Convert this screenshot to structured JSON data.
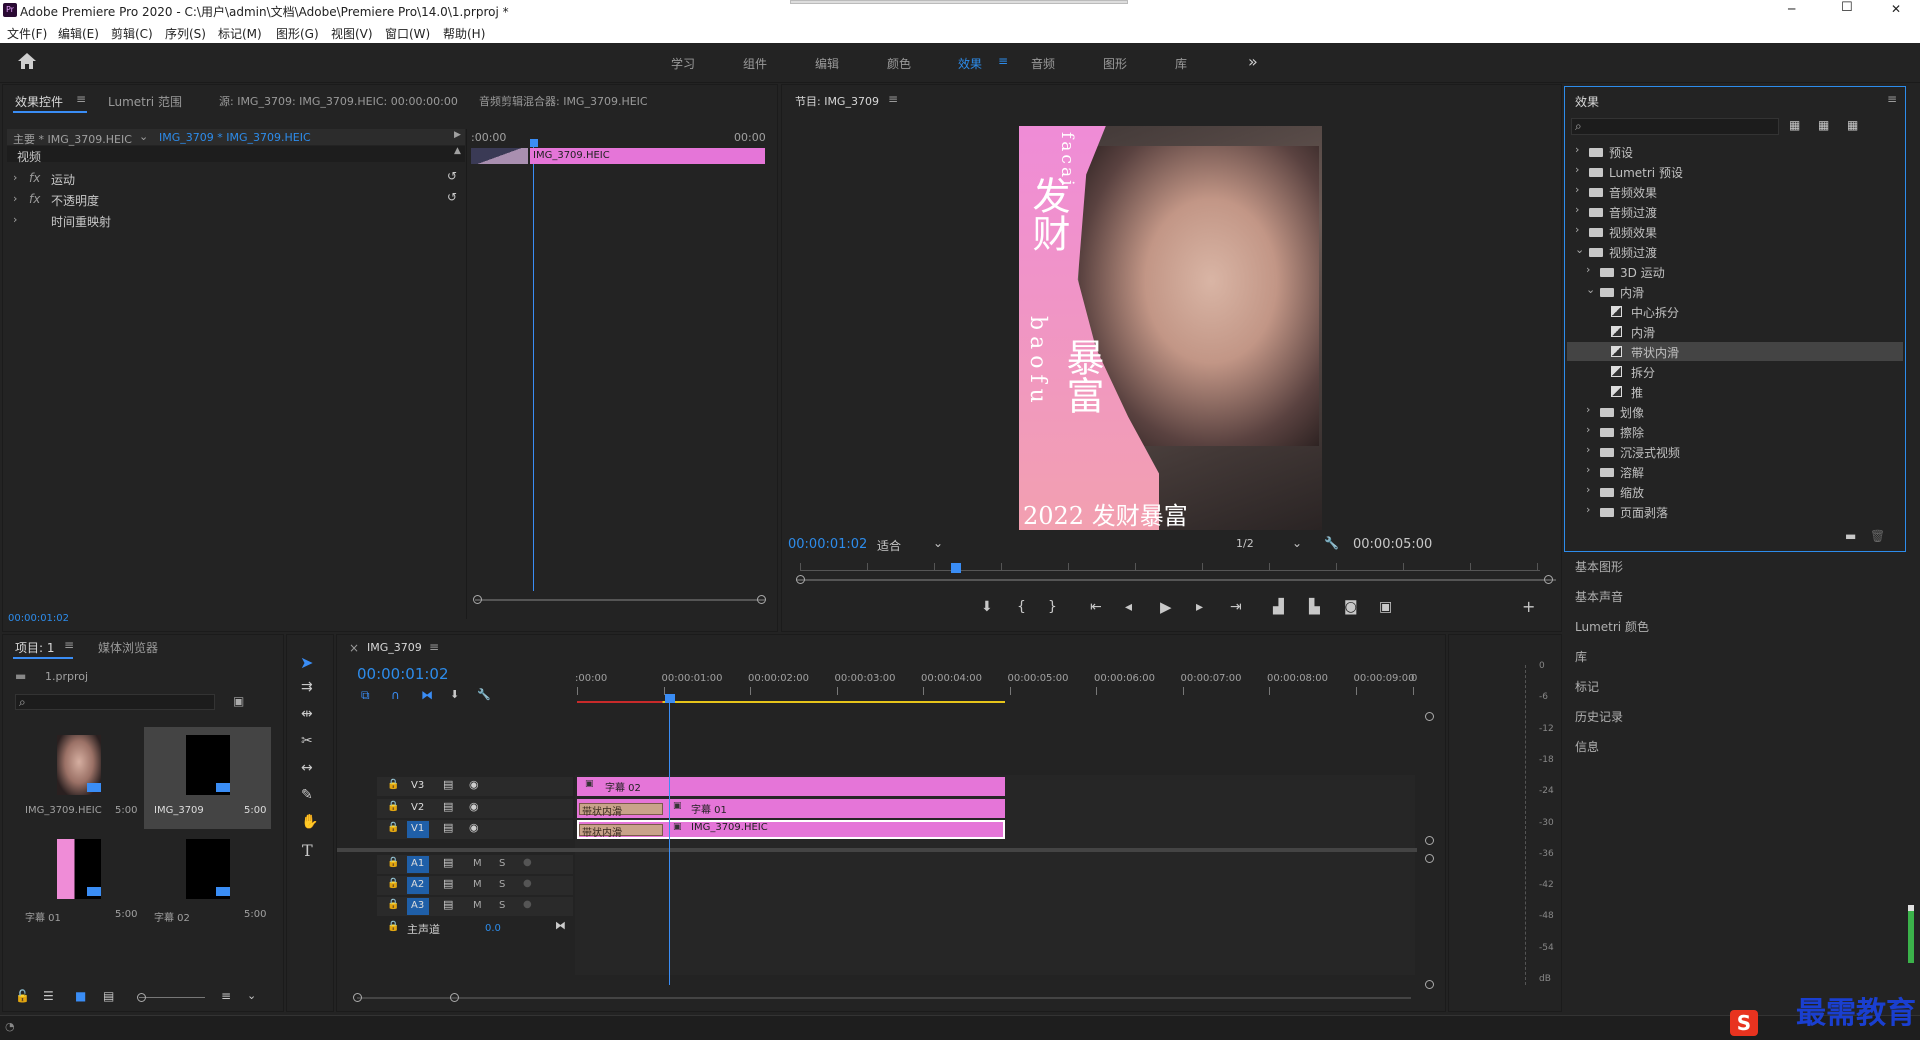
{
  "window": {
    "app_icon": "Pr",
    "title": "Adobe Premiere Pro 2020 - C:\\用户\\admin\\文档\\Adobe\\Premiere Pro\\14.0\\1.prproj *",
    "min": "─",
    "max": "☐",
    "close": "✕"
  },
  "menu": [
    "文件(F)",
    "编辑(E)",
    "剪辑(C)",
    "序列(S)",
    "标记(M)",
    "图形(G)",
    "视图(V)",
    "窗口(W)",
    "帮助(H)"
  ],
  "workspaces": [
    "学习",
    "组件",
    "编辑",
    "颜色",
    "效果",
    "音频",
    "图形",
    "库"
  ],
  "workspace_active": "效果",
  "more": "»",
  "source": {
    "tabs": [
      "效果控件",
      "Lumetri 范围",
      "源: IMG_3709: IMG_3709.HEIC: 00:00:00:00",
      "音频剪辑混合器: IMG_3709.HEIC"
    ],
    "menu_icon": "≡",
    "master": "主要 * IMG_3709.HEIC",
    "seq": "IMG_3709 * IMG_3709.HEIC",
    "section": "视频",
    "props": [
      "运动",
      "不透明度",
      "时间重映射"
    ],
    "fx": "fx",
    "ruler": [
      ":00:00",
      "00:00"
    ],
    "clip": "IMG_3709.HEIC",
    "timecode": "00:00:01:02"
  },
  "program": {
    "title": "节目: IMG_3709",
    "timecode": "00:00:01:02",
    "fit": "适合",
    "quality": "1/2",
    "duration": "00:00:05:00",
    "poster": {
      "vertical1": "发财",
      "vertical2": "暴富",
      "latin1": "facai",
      "latin2": "baofu",
      "bottom": "2022 发财暴富"
    }
  },
  "effects": {
    "title": "效果",
    "search_placeholder": "",
    "tree": [
      {
        "label": "预设",
        "level": 0,
        "open": false
      },
      {
        "label": "Lumetri 预设",
        "level": 0,
        "open": false
      },
      {
        "label": "音频效果",
        "level": 0,
        "open": false
      },
      {
        "label": "音频过渡",
        "level": 0,
        "open": false
      },
      {
        "label": "视频效果",
        "level": 0,
        "open": false
      },
      {
        "label": "视频过渡",
        "level": 0,
        "open": true
      },
      {
        "label": "3D 运动",
        "level": 1,
        "open": false
      },
      {
        "label": "内滑",
        "level": 1,
        "open": true
      },
      {
        "label": "中心拆分",
        "level": 2,
        "item": true
      },
      {
        "label": "内滑",
        "level": 2,
        "item": true
      },
      {
        "label": "带状内滑",
        "level": 2,
        "item": true,
        "selected": true
      },
      {
        "label": "拆分",
        "level": 2,
        "item": true
      },
      {
        "label": "推",
        "level": 2,
        "item": true
      },
      {
        "label": "划像",
        "level": 1,
        "open": false
      },
      {
        "label": "擦除",
        "level": 1,
        "open": false
      },
      {
        "label": "沉浸式视频",
        "level": 1,
        "open": false
      },
      {
        "label": "溶解",
        "level": 1,
        "open": false
      },
      {
        "label": "缩放",
        "level": 1,
        "open": false
      },
      {
        "label": "页面剥落",
        "level": 1,
        "open": false
      }
    ],
    "collapsed": [
      "基本图形",
      "基本声音",
      "Lumetri 颜色",
      "库",
      "标记",
      "历史记录",
      "信息"
    ]
  },
  "project": {
    "tabs": [
      "项目: 1",
      "媒体浏览器"
    ],
    "file": "1.prproj",
    "items": [
      {
        "name": "IMG_3709.HEIC",
        "dur": "5:00"
      },
      {
        "name": "IMG_3709",
        "dur": "5:00"
      },
      {
        "name": "字幕 01",
        "dur": "5:00"
      },
      {
        "name": "字幕 02",
        "dur": "5:00"
      }
    ]
  },
  "timeline": {
    "title": "IMG_3709",
    "close": "×",
    "timecode": "00:00:01:02",
    "ruler": [
      ":00:00",
      "00:00:01:00",
      "00:00:02:00",
      "00:00:03:00",
      "00:00:04:00",
      "00:00:05:00",
      "00:00:06:00",
      "00:00:07:00",
      "00:00:08:00",
      "00:00:09:00",
      "0"
    ],
    "vtracks": [
      "V3",
      "V2",
      "V1"
    ],
    "atracks": [
      "A1",
      "A2",
      "A3"
    ],
    "master": "主声道",
    "master_val": "0.0",
    "m": "M",
    "s": "S",
    "clips": {
      "v3": "字幕 02",
      "v2": "字幕 01",
      "v1": "IMG_3709.HEIC",
      "trans": "带状内滑"
    }
  },
  "meter": [
    "0",
    "-6",
    "-12",
    "-18",
    "-24",
    "-30",
    "-36",
    "-42",
    "-48",
    "-54",
    "dB"
  ],
  "watermark": "最需教育",
  "colors": {
    "accent": "#2d8ceb",
    "clip": "#e575d8",
    "transition": "#c9a38a",
    "panel": "#232323"
  }
}
